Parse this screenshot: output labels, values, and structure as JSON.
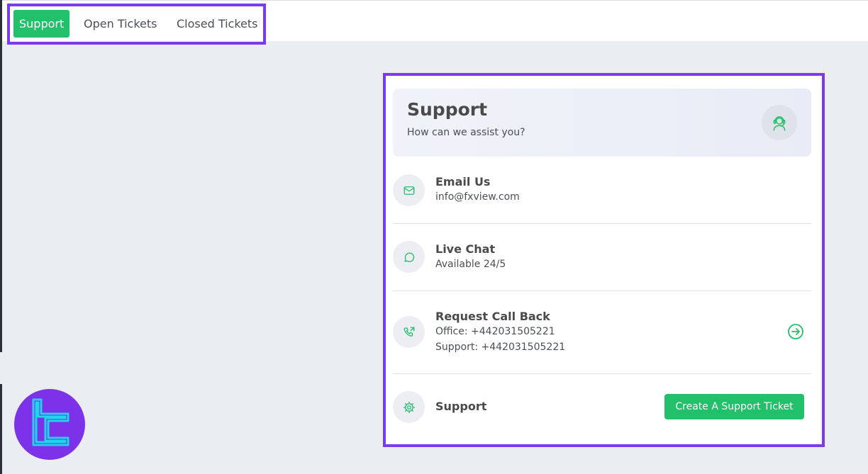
{
  "tabs": [
    {
      "label": "Support",
      "active": true
    },
    {
      "label": "Open Tickets",
      "active": false
    },
    {
      "label": "Closed Tickets",
      "active": false
    }
  ],
  "hero": {
    "title": "Support",
    "subtitle": "How can we assist you?",
    "icon": "support-agent-icon"
  },
  "contacts": {
    "email": {
      "title": "Email Us",
      "value": "info@fxview.com",
      "icon": "mail-icon"
    },
    "chat": {
      "title": "Live Chat",
      "value": "Available 24/5",
      "icon": "chat-bubble-icon"
    },
    "callback": {
      "title": "Request Call Back",
      "office": "Office: +442031505221",
      "support": "Support: +442031505221",
      "icon": "phone-callback-icon",
      "action_icon": "arrow-right-circle-icon"
    },
    "ticket": {
      "title": "Support",
      "button_label": "Create A Support Ticket",
      "icon": "gear-icon"
    }
  },
  "colors": {
    "accent": "#22c06b",
    "highlight": "#7c3aed",
    "logo_bg": "#7b32e8",
    "logo_fg": "#22d3ee"
  }
}
